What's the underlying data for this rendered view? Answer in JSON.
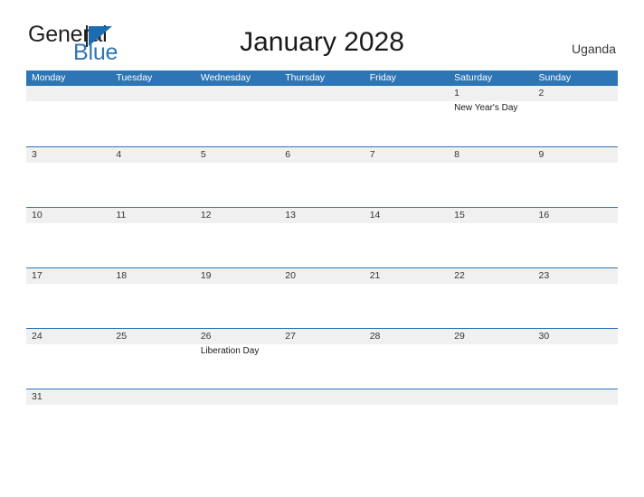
{
  "brand": {
    "name_top": "General",
    "name_bottom": "Blue"
  },
  "header": {
    "title": "January 2028",
    "country": "Uganda"
  },
  "colors": {
    "header_blue": "#2e75b6",
    "band_gray": "#f0f0f0",
    "brand_blue": "#2e75b6",
    "text_dark": "#1a1a1a"
  },
  "calendar": {
    "weekdays": [
      "Monday",
      "Tuesday",
      "Wednesday",
      "Thursday",
      "Friday",
      "Saturday",
      "Sunday"
    ],
    "weeks": [
      [
        {
          "day": "",
          "event": ""
        },
        {
          "day": "",
          "event": ""
        },
        {
          "day": "",
          "event": ""
        },
        {
          "day": "",
          "event": ""
        },
        {
          "day": "",
          "event": ""
        },
        {
          "day": "1",
          "event": "New Year's Day"
        },
        {
          "day": "2",
          "event": ""
        }
      ],
      [
        {
          "day": "3",
          "event": ""
        },
        {
          "day": "4",
          "event": ""
        },
        {
          "day": "5",
          "event": ""
        },
        {
          "day": "6",
          "event": ""
        },
        {
          "day": "7",
          "event": ""
        },
        {
          "day": "8",
          "event": ""
        },
        {
          "day": "9",
          "event": ""
        }
      ],
      [
        {
          "day": "10",
          "event": ""
        },
        {
          "day": "11",
          "event": ""
        },
        {
          "day": "12",
          "event": ""
        },
        {
          "day": "13",
          "event": ""
        },
        {
          "day": "14",
          "event": ""
        },
        {
          "day": "15",
          "event": ""
        },
        {
          "day": "16",
          "event": ""
        }
      ],
      [
        {
          "day": "17",
          "event": ""
        },
        {
          "day": "18",
          "event": ""
        },
        {
          "day": "19",
          "event": ""
        },
        {
          "day": "20",
          "event": ""
        },
        {
          "day": "21",
          "event": ""
        },
        {
          "day": "22",
          "event": ""
        },
        {
          "day": "23",
          "event": ""
        }
      ],
      [
        {
          "day": "24",
          "event": ""
        },
        {
          "day": "25",
          "event": ""
        },
        {
          "day": "26",
          "event": "Liberation Day"
        },
        {
          "day": "27",
          "event": ""
        },
        {
          "day": "28",
          "event": ""
        },
        {
          "day": "29",
          "event": ""
        },
        {
          "day": "30",
          "event": ""
        }
      ],
      [
        {
          "day": "31",
          "event": ""
        },
        {
          "day": "",
          "event": ""
        },
        {
          "day": "",
          "event": ""
        },
        {
          "day": "",
          "event": ""
        },
        {
          "day": "",
          "event": ""
        },
        {
          "day": "",
          "event": ""
        },
        {
          "day": "",
          "event": ""
        }
      ]
    ]
  }
}
